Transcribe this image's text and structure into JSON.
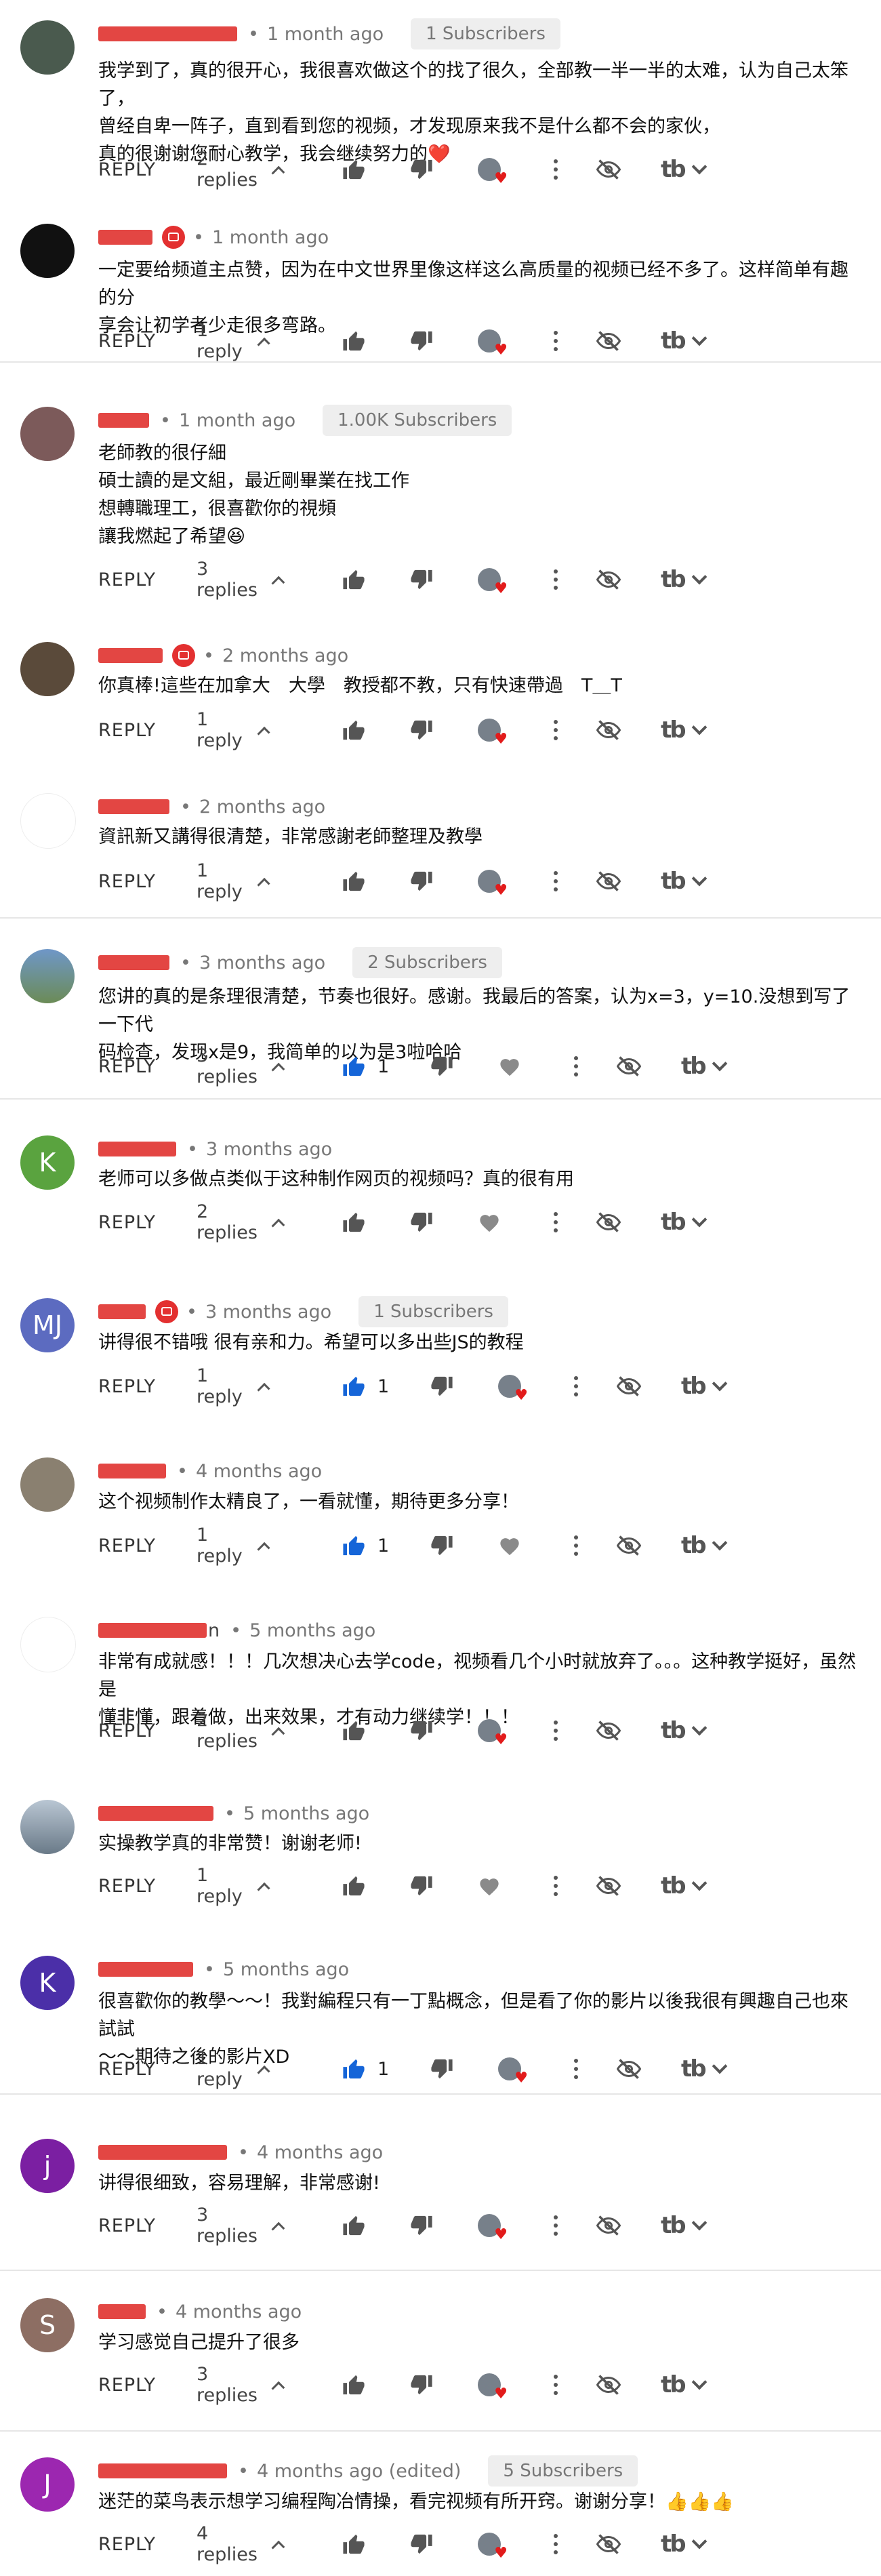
{
  "comments": [
    {
      "avatar": {
        "letter": "",
        "color": "#4a5a4e"
      },
      "time": "1 month ago",
      "badge": "1 Subscribers",
      "lines": [
        "我学到了，真的很开心，我很喜欢做这个的找了很久，全部教一半一半的太难，认为自己太笨了，",
        "曾经自卑一阵子，直到看到您的视频，才发现原来我不是什么都不会的家伙，",
        "真的很谢谢您耐心教学，我会继续努力的❤️"
      ],
      "reply_label": "REPLY",
      "replies": "2 replies",
      "likes": ""
    },
    {
      "avatar": {
        "letter": "",
        "color": "#111"
      },
      "time": "1 month ago",
      "badge": "",
      "lines": [
        "一定要给频道主点赞，因为在中文世界里像这样这么高质量的视频已经不多了。这样简单有趣的分",
        "享会让初学者少走很多弯路。"
      ],
      "reply_label": "REPLY",
      "replies": "1 reply",
      "likes": ""
    },
    {
      "avatar": {
        "letter": "",
        "color": "#7c5a5a"
      },
      "time": "1 month ago",
      "badge": "1.00K Subscribers",
      "lines": [
        "老師教的很仔細",
        "碩士讀的是文組，最近剛畢業在找工作",
        "想轉職理工，很喜歡你的視頻",
        "讓我燃起了希望😆"
      ],
      "reply_label": "REPLY",
      "replies": "3 replies",
      "likes": ""
    },
    {
      "avatar": {
        "letter": "",
        "color": "#5a4a3a"
      },
      "time": "2 months ago",
      "badge": "",
      "lines": [
        "你真棒!這些在加拿大　大學　教授都不教，只有快速帶過　T＿T"
      ],
      "reply_label": "REPLY",
      "replies": "1 reply",
      "likes": ""
    },
    {
      "avatar": {
        "letter": "",
        "color": "#fff"
      },
      "time": "2 months ago",
      "badge": "",
      "lines": [
        "資訊新又講得很清楚，非常感謝老師整理及教學"
      ],
      "reply_label": "REPLY",
      "replies": "1 reply",
      "likes": ""
    },
    {
      "avatar": {
        "letter": "",
        "color": "#5d88b4"
      },
      "time": "3 months ago",
      "badge": "2 Subscribers",
      "lines": [
        "您讲的真的是条理很清楚，节奏也很好。感谢。我最后的答案，认为x=3，y=10.没想到写了一下代",
        "码检查，发现x是9，我简单的以为是3啦哈哈"
      ],
      "reply_label": "REPLY",
      "replies": "3 replies",
      "likes": "1"
    },
    {
      "avatar": {
        "letter": "K",
        "color": "#5aa33f"
      },
      "time": "3 months ago",
      "badge": "",
      "lines": [
        "老师可以多做点类似于这种制作网页的视频吗？真的很有用"
      ],
      "reply_label": "REPLY",
      "replies": "2 replies",
      "likes": ""
    },
    {
      "avatar": {
        "letter": "MJ",
        "color": "#5c6bc0"
      },
      "time": "3 months ago",
      "badge": "1 Subscribers",
      "lines": [
        "讲得很不错哦 很有亲和力。希望可以多出些JS的教程"
      ],
      "reply_label": "REPLY",
      "replies": "1 reply",
      "likes": "1"
    },
    {
      "avatar": {
        "letter": "",
        "color": "#8a8070"
      },
      "time": "4 months ago",
      "badge": "",
      "lines": [
        "这个视频制作太精良了，一看就懂，期待更多分享！"
      ],
      "reply_label": "REPLY",
      "replies": "1 reply",
      "likes": "1"
    },
    {
      "avatar": {
        "letter": "",
        "color": "#fff"
      },
      "time": "5 months ago",
      "badge": "",
      "name_suffix": "n",
      "lines": [
        "非常有成就感！！！几次想决心去学code，视频看几个小时就放弃了。。。这种教学挺好，虽然是",
        "懂非懂，跟着做，出来效果，才有动力继续学！！！"
      ],
      "reply_label": "REPLY",
      "replies": "2 replies",
      "likes": ""
    },
    {
      "avatar": {
        "letter": "",
        "color": "#6a7a88"
      },
      "time": "5 months ago",
      "badge": "",
      "lines": [
        "实操教学真的非常赞！谢谢老师!"
      ],
      "reply_label": "REPLY",
      "replies": "1 reply",
      "likes": ""
    },
    {
      "avatar": {
        "letter": "K",
        "color": "#4b2fa8"
      },
      "time": "5 months ago",
      "badge": "",
      "lines": [
        "很喜歡你的教學～～！我對編程只有一丁點概念，但是看了你的影片以後我很有興趣自己也來試試",
        "～～期待之後的影片XD"
      ],
      "reply_label": "REPLY",
      "replies": "1 reply",
      "likes": "1"
    },
    {
      "avatar": {
        "letter": "j",
        "color": "#7b1fa2"
      },
      "time": "4 months ago",
      "badge": "",
      "lines": [
        "讲得很细致，容易理解，非常感谢!"
      ],
      "reply_label": "REPLY",
      "replies": "3 replies",
      "likes": ""
    },
    {
      "avatar": {
        "letter": "S",
        "color": "#8d6e63"
      },
      "time": "4 months ago",
      "badge": "",
      "lines": [
        "学习感觉自己提升了很多"
      ],
      "reply_label": "REPLY",
      "replies": "3 replies",
      "likes": ""
    },
    {
      "avatar": {
        "letter": "J",
        "color": "#9c27b0"
      },
      "time": "4 months ago (edited)",
      "badge": "5 Subscribers",
      "lines": [
        "迷茫的菜鸟表示想学习编程陶冶情操，看完视频有所开窍。谢谢分享！👍👍👍"
      ],
      "reply_label": "REPLY",
      "replies": "4 replies",
      "likes": ""
    }
  ]
}
